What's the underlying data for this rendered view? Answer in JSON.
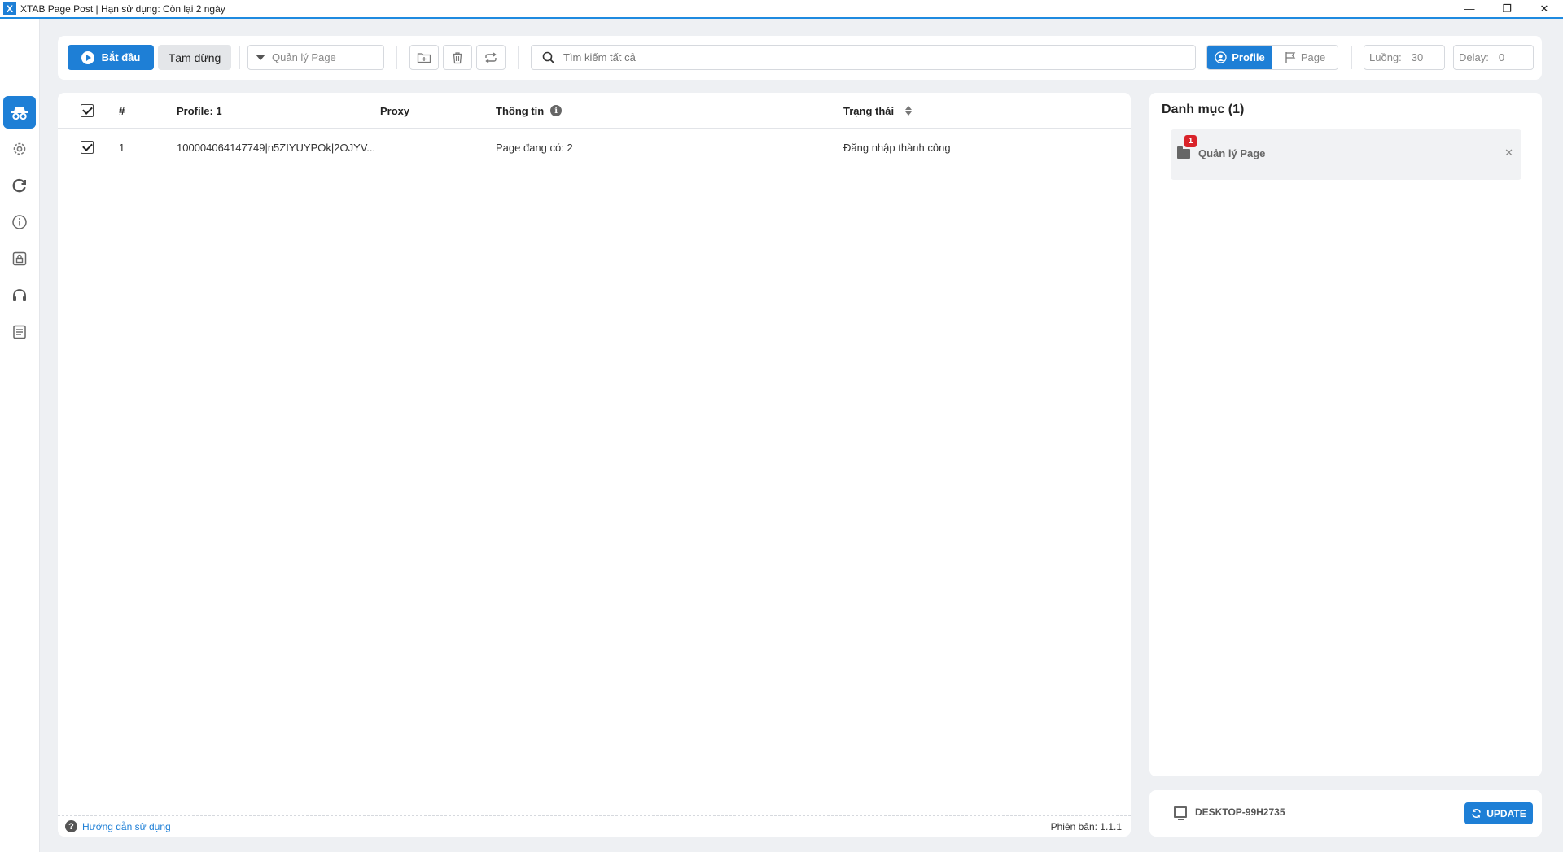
{
  "window": {
    "title": "XTAB Page Post | Hạn sử dụng: Còn lại 2 ngày",
    "logo_text": "X",
    "controls": {
      "minimize": "—",
      "restore": "❐",
      "close": "✕"
    }
  },
  "sidebar": {
    "items": [
      {
        "icon": "incognito-icon",
        "active": true
      },
      {
        "icon": "gear-icon",
        "active": false
      },
      {
        "icon": "refresh-icon",
        "active": false
      },
      {
        "icon": "info-icon",
        "active": false
      },
      {
        "icon": "lock-icon",
        "active": false
      },
      {
        "icon": "headset-icon",
        "active": false
      },
      {
        "icon": "notes-icon",
        "active": false
      }
    ]
  },
  "toolbar": {
    "start_label": "Bắt đầu",
    "pause_label": "Tạm dừng",
    "category_select": "Quản lý Page",
    "search_placeholder": "Tìm kiếm tất cả",
    "view_profile_label": "Profile",
    "view_page_label": "Page",
    "threads_label": "Luồng:",
    "threads_value": "30",
    "delay_label": "Delay:",
    "delay_value": "0"
  },
  "table": {
    "columns": {
      "index": "#",
      "profile": "Profile: 1",
      "proxy": "Proxy",
      "info": "Thông tin",
      "status": "Trạng thái"
    },
    "rows": [
      {
        "checked": true,
        "index": "1",
        "profile": "100004064147749|n5ZIYUYPOk|2OJYV...",
        "proxy": "",
        "info": "Page đang có: 2",
        "status": "Đăng nhập thành công"
      }
    ],
    "footer": {
      "help_label": "Hướng dẫn sử dụng",
      "version": "Phiên bản: 1.1.1"
    }
  },
  "categories": {
    "title": "Danh mục (1)",
    "items": [
      {
        "name": "Quản lý Page",
        "count": "1"
      }
    ]
  },
  "machine": {
    "name": "DESKTOP-99H2735",
    "update_label": "UPDATE"
  },
  "colors": {
    "accent": "#1e7fd6",
    "badge": "#d9232a",
    "background": "#eef0f3"
  }
}
